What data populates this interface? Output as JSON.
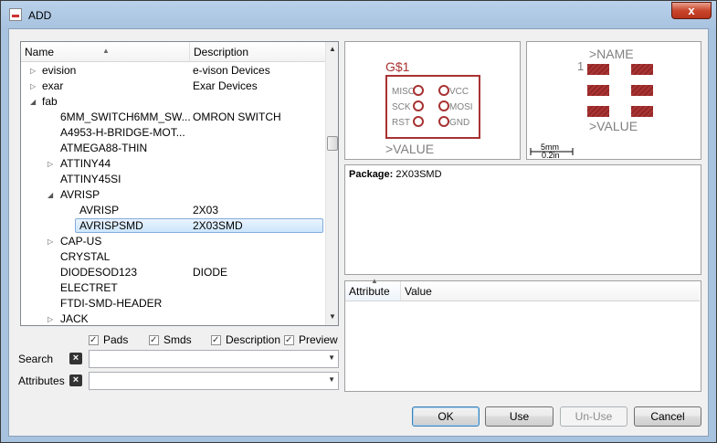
{
  "window": {
    "title": "ADD",
    "close_glyph": "x"
  },
  "tree": {
    "columns": {
      "name": "Name",
      "description": "Description"
    },
    "rows": [
      {
        "indent": 0,
        "expander": "closed",
        "name": "evision",
        "desc": "e-vison Devices"
      },
      {
        "indent": 0,
        "expander": "closed",
        "name": "exar",
        "desc": "Exar Devices"
      },
      {
        "indent": 0,
        "expander": "open",
        "name": "fab",
        "desc": ""
      },
      {
        "indent": 1,
        "expander": "none",
        "name": "6MM_SWITCH6MM_SW...",
        "desc": "OMRON SWITCH"
      },
      {
        "indent": 1,
        "expander": "none",
        "name": "A4953-H-BRIDGE-MOT...",
        "desc": ""
      },
      {
        "indent": 1,
        "expander": "none",
        "name": "ATMEGA88-THIN",
        "desc": ""
      },
      {
        "indent": 1,
        "expander": "closed",
        "name": "ATTINY44",
        "desc": ""
      },
      {
        "indent": 1,
        "expander": "none",
        "name": "ATTINY45SI",
        "desc": ""
      },
      {
        "indent": 1,
        "expander": "open",
        "name": "AVRISP",
        "desc": ""
      },
      {
        "indent": 2,
        "expander": "none",
        "name": "AVRISP",
        "desc": "2X03"
      },
      {
        "indent": 2,
        "expander": "none",
        "name": "AVRISPSMD",
        "desc": "2X03SMD",
        "selected": true
      },
      {
        "indent": 1,
        "expander": "closed",
        "name": "CAP-US",
        "desc": ""
      },
      {
        "indent": 1,
        "expander": "none",
        "name": "CRYSTAL",
        "desc": ""
      },
      {
        "indent": 1,
        "expander": "none",
        "name": "DIODESOD123",
        "desc": "DIODE"
      },
      {
        "indent": 1,
        "expander": "none",
        "name": "ELECTRET",
        "desc": ""
      },
      {
        "indent": 1,
        "expander": "none",
        "name": "FTDI-SMD-HEADER",
        "desc": ""
      },
      {
        "indent": 1,
        "expander": "closed",
        "name": "JACK",
        "desc": ""
      }
    ]
  },
  "options": {
    "pads": "Pads",
    "smds": "Smds",
    "description": "Description",
    "preview": "Preview"
  },
  "search": {
    "label": "Search",
    "value": ""
  },
  "attributes_filter": {
    "label": "Attributes",
    "value": ""
  },
  "schematic_preview": {
    "name_label": "G$1",
    "value_label": ">VALUE",
    "pins_left": [
      "MISO",
      "SCK",
      "RST"
    ],
    "pins_right": [
      "VCC",
      "MOSI",
      "GND"
    ]
  },
  "package_preview": {
    "name_label": ">NAME",
    "value_label": ">VALUE",
    "pin1_label": "1",
    "scale_mm": "5mm",
    "scale_in": "0.2in"
  },
  "package_info": {
    "label": "Package:",
    "value": "2X03SMD"
  },
  "attribute_table": {
    "col_attribute": "Attribute",
    "col_value": "Value"
  },
  "buttons": {
    "ok": "OK",
    "use": "Use",
    "unuse": "Un-Use",
    "cancel": "Cancel"
  },
  "colors": {
    "symbol": "#a83232",
    "pad": "#a83232",
    "selection": "#cde6fb",
    "title_bar": "#a8c3e0"
  }
}
